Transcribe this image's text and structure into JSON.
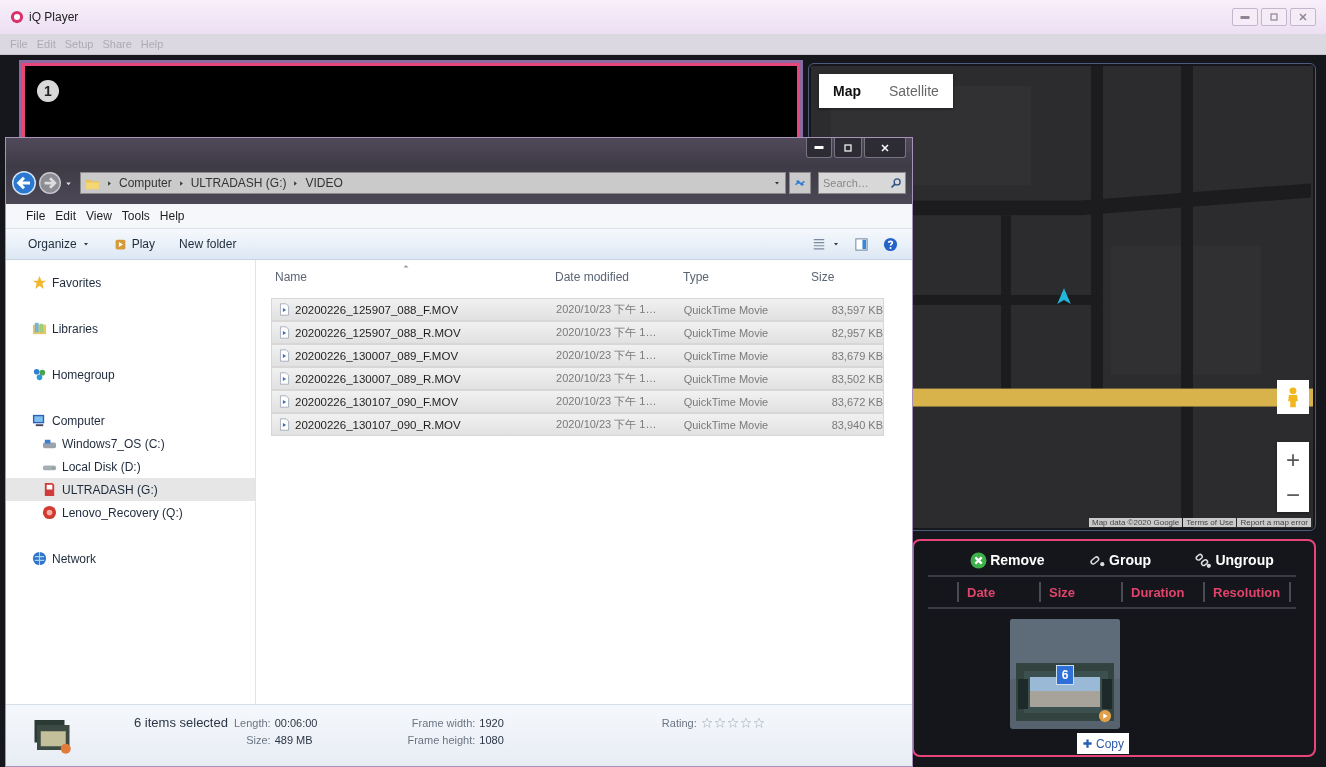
{
  "window": {
    "title": "iQ Player"
  },
  "menu": [
    {
      "label": "File",
      "disabled": true
    },
    {
      "label": "Edit",
      "disabled": true
    },
    {
      "label": "Setup",
      "disabled": true
    },
    {
      "label": "Share",
      "disabled": true
    },
    {
      "label": "Help",
      "disabled": true
    }
  ],
  "video_panel": {
    "badge": "1"
  },
  "map": {
    "tabs": [
      {
        "label": "Map",
        "selected": true
      },
      {
        "label": "Satellite",
        "selected": false
      }
    ],
    "zoom_in": "+",
    "zoom_out": "−",
    "attribution": [
      "Map data ©2020 Google",
      "Terms of Use",
      "Report a map error"
    ]
  },
  "clip_panel": {
    "actions": [
      {
        "label": "Remove",
        "kind": "remove"
      },
      {
        "label": "Group",
        "kind": "group"
      },
      {
        "label": "Ungroup",
        "kind": "ungroup"
      }
    ],
    "columns": [
      "Date",
      "Size",
      "Duration",
      "Resolution"
    ],
    "clip": {
      "count": "6",
      "button": "Copy"
    }
  },
  "explorer": {
    "breadcrumb": [
      "Computer",
      "ULTRADASH (G:)",
      "VIDEO"
    ],
    "search": {
      "placeholder": "Search…"
    },
    "menu": [
      "File",
      "Edit",
      "View",
      "Tools",
      "Help"
    ],
    "toolbar": [
      {
        "label": "Organize",
        "kind": "menu"
      },
      {
        "label": "Play",
        "kind": "play"
      },
      {
        "label": "New folder",
        "kind": "plain"
      }
    ],
    "nav": [
      {
        "label": "Favorites",
        "kind": "favorites",
        "selected": false
      },
      {
        "label": "Libraries",
        "kind": "libraries",
        "selected": false
      },
      {
        "label": "Homegroup",
        "kind": "homegroup",
        "selected": false
      },
      {
        "label": "Computer",
        "kind": "computer",
        "selected": false,
        "children": [
          {
            "label": "Windows7_OS (C:)",
            "kind": "system-drive",
            "selected": false
          },
          {
            "label": "Local Disk (D:)",
            "kind": "disk",
            "selected": false
          },
          {
            "label": "ULTRADASH (G:)",
            "kind": "sd-card",
            "selected": true
          },
          {
            "label": "Lenovo_Recovery (Q:)",
            "kind": "recovery",
            "selected": false
          }
        ]
      },
      {
        "label": "Network",
        "kind": "network",
        "selected": false
      }
    ],
    "columns": [
      "Name",
      "Date modified",
      "Type",
      "Size"
    ],
    "files": [
      {
        "name": "20200226_125907_088_F.MOV",
        "date": "2020/10/23 下午 1…",
        "type": "QuickTime Movie",
        "size": "83,597 KB",
        "selected": true
      },
      {
        "name": "20200226_125907_088_R.MOV",
        "date": "2020/10/23 下午 1…",
        "type": "QuickTime Movie",
        "size": "82,957 KB",
        "selected": true
      },
      {
        "name": "20200226_130007_089_F.MOV",
        "date": "2020/10/23 下午 1…",
        "type": "QuickTime Movie",
        "size": "83,679 KB",
        "selected": true
      },
      {
        "name": "20200226_130007_089_R.MOV",
        "date": "2020/10/23 下午 1…",
        "type": "QuickTime Movie",
        "size": "83,502 KB",
        "selected": true
      },
      {
        "name": "20200226_130107_090_F.MOV",
        "date": "2020/10/23 下午 1…",
        "type": "QuickTime Movie",
        "size": "83,672 KB",
        "selected": true
      },
      {
        "name": "20200226_130107_090_R.MOV",
        "date": "2020/10/23 下午 1…",
        "type": "QuickTime Movie",
        "size": "83,940 KB",
        "selected": true
      }
    ],
    "status": {
      "summary": "6 items selected",
      "field_groups": [
        {
          "fields": [
            {
              "label": "Length:",
              "value": "00:06:00"
            },
            {
              "label": "Size:",
              "value": "489 MB"
            }
          ]
        },
        {
          "fields": [
            {
              "label": "Frame width:",
              "value": "1920"
            },
            {
              "label": "Frame height:",
              "value": "1080"
            }
          ]
        }
      ],
      "rating_label": "Rating:",
      "stars": 0
    }
  }
}
